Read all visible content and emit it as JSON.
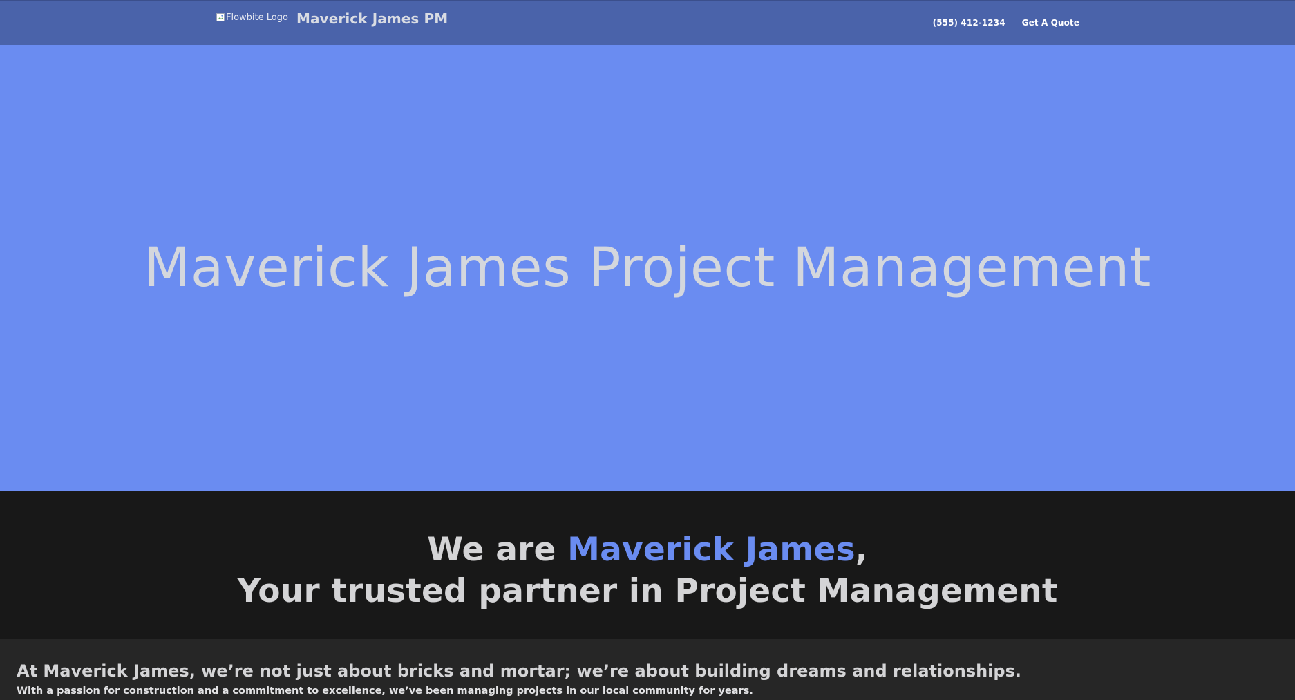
{
  "navbar": {
    "logo_alt": "Flowbite Logo",
    "brand_name": "Maverick James PM",
    "links": [
      {
        "label": "(555) 412-1234"
      },
      {
        "label": "Get A Quote"
      }
    ]
  },
  "hero": {
    "title": "Maverick James Project Management"
  },
  "about": {
    "line1_prefix": "We are ",
    "line1_highlight": "Maverick James",
    "line1_suffix": ",",
    "line2": "Your trusted partner in Project Management"
  },
  "intro": {
    "heading": "At Maverick James, we’re not just about bricks and mortar; we’re about building dreams and relationships.",
    "text": "With a passion for construction and a commitment to excellence, we’ve been managing projects in our local community for years."
  },
  "colors": {
    "navbar_bg": "#4a63aa",
    "hero_bg": "#6a8cf1",
    "accent": "#6a8cf1",
    "dark_bg": "#181818",
    "section_bg": "#262626",
    "text_light": "#d4d4d6"
  }
}
